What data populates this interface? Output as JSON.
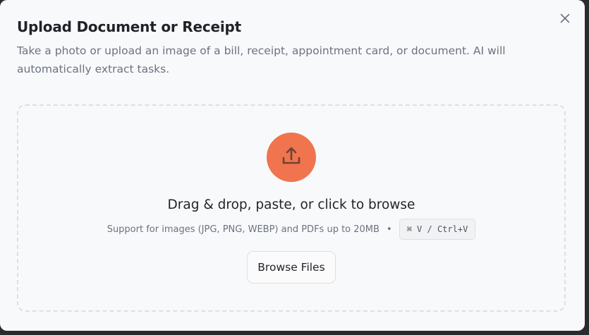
{
  "dialog": {
    "title": "Upload Document or Receipt",
    "description": "Take a photo or upload an image of a bill, receipt, appointment card, or document. AI will automatically extract tasks.",
    "close_icon": "close-icon"
  },
  "dropzone": {
    "icon": "upload-icon",
    "headline": "Drag & drop, paste, or click to browse",
    "support_text": "Support for images (JPG, PNG, WEBP) and PDFs up to 20MB",
    "separator": "•",
    "shortcut": "⌘ V / Ctrl+V",
    "browse_label": "Browse Files"
  },
  "colors": {
    "accent": "#f0744d",
    "background": "#f8f9fb",
    "text": "#1f2328",
    "muted": "#6b7280"
  }
}
